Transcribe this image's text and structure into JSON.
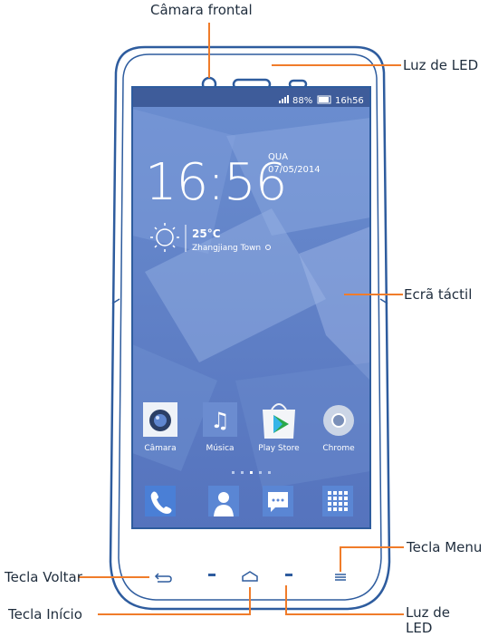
{
  "callouts": {
    "front_camera": "Câmara frontal",
    "led_top": "Luz de LED",
    "touchscreen": "Ecrã táctil",
    "menu_key": "Tecla Menu",
    "back_key": "Tecla Voltar",
    "home_key": "Tecla Início",
    "led_bottom_line1": "Luz de",
    "led_bottom_line2": "LED"
  },
  "screen": {
    "status": {
      "battery": "88%",
      "time": "16h56"
    },
    "clock": {
      "time": "16:56",
      "day": "QUA",
      "date": "07/05/2014"
    },
    "weather": {
      "temp": "25°C",
      "location": "Zhangjiang Town"
    },
    "apps": [
      "Câmara",
      "Música",
      "Play Store",
      "Chrome"
    ],
    "page_dots": 5,
    "active_dot": 2
  },
  "colors": {
    "accent": "#f07c2a",
    "frame": "#2e5c9e",
    "screen": "#5b7fc4"
  }
}
